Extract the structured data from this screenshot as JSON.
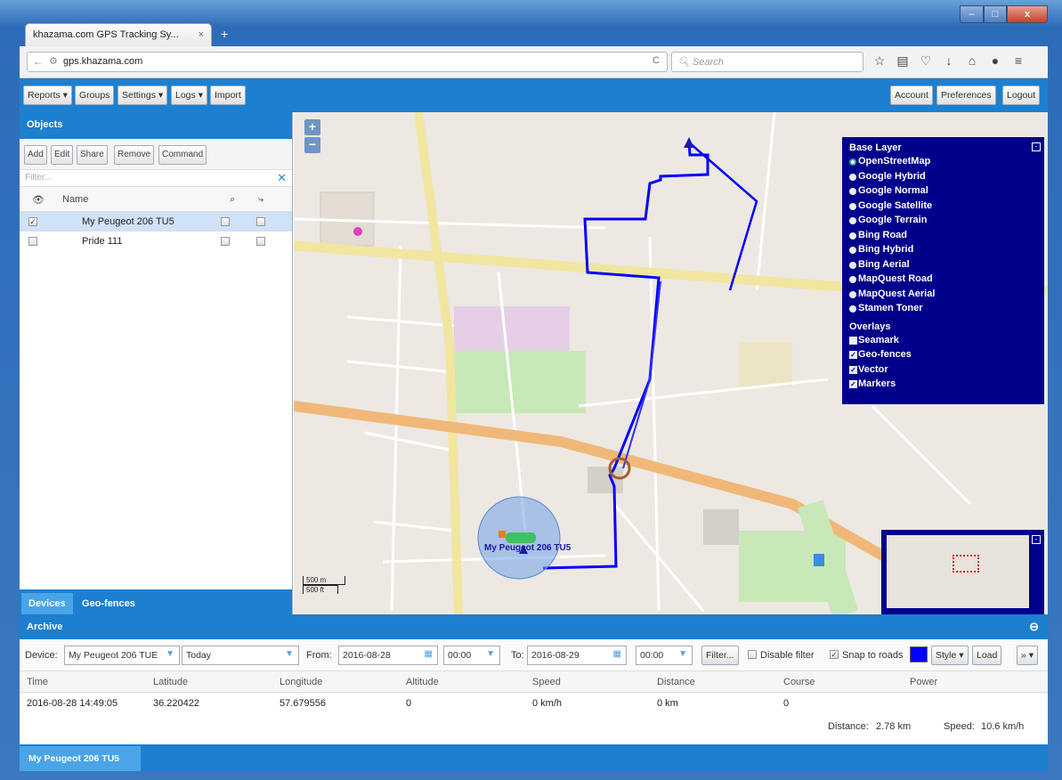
{
  "browser": {
    "tab_title": "khazama.com GPS Tracking Sy...",
    "tab_close": "×",
    "new_tab": "+",
    "url": "gps.khazama.com",
    "search_placeholder": "Search"
  },
  "toolbar": {
    "left": [
      "Reports",
      "Groups",
      "Settings",
      "Logs",
      "Import"
    ],
    "right": [
      "Account",
      "Preferences",
      "Logout"
    ]
  },
  "objects": {
    "title": "Objects",
    "buttons": [
      "Add",
      "Edit",
      "Share",
      "Remove",
      "Command"
    ],
    "filter_placeholder": "Filter...",
    "col_name": "Name",
    "rows": [
      {
        "name": "My Peugeot 206 TU5",
        "checked": true
      },
      {
        "name": "Pride 111",
        "checked": false
      }
    ],
    "tabs": [
      "Devices",
      "Geo-fences"
    ]
  },
  "map": {
    "base_layer_title": "Base Layer",
    "base_layers": [
      "OpenStreetMap",
      "Google Hybrid",
      "Google Normal",
      "Google Satellite",
      "Google Terrain",
      "Bing Road",
      "Bing Hybrid",
      "Bing Aerial",
      "MapQuest Road",
      "MapQuest Aerial",
      "Stamen Toner"
    ],
    "overlays_title": "Overlays",
    "overlays": [
      {
        "name": "Seamark",
        "checked": false
      },
      {
        "name": "Geo-fences",
        "checked": true
      },
      {
        "name": "Vector",
        "checked": true
      },
      {
        "name": "Markers",
        "checked": true
      }
    ],
    "vehicle_label": "My Peugeot 206 TU5",
    "scale_m": "500 m",
    "scale_ft": "500 ft",
    "colors": {
      "track": "#0000ff",
      "panel": "#00008b",
      "vehicle_circle": "#6fa0e8"
    }
  },
  "archive": {
    "title": "Archive",
    "device_label": "Device:",
    "device_value": "My Peugeot 206 TUE",
    "period_value": "Today",
    "from_label": "From:",
    "from_date": "2016-08-28",
    "from_time": "00:00",
    "to_label": "To:",
    "to_date": "2016-08-29",
    "to_time": "00:00",
    "filter_btn": "Filter...",
    "disable_filter": "Disable filter",
    "snap_to_roads": "Snap to roads",
    "style_btn": "Style",
    "load_btn": "Load",
    "more_btn": "»",
    "columns": [
      "Time",
      "Latitude",
      "Longitude",
      "Altitude",
      "Speed",
      "Distance",
      "Course",
      "Power"
    ],
    "row": [
      "2016-08-28 14:49:05",
      "36.220422",
      "57.679556",
      "0",
      "0 km/h",
      "0 km",
      "0",
      ""
    ],
    "distance_label": "Distance:",
    "distance_value": "2.78 km",
    "speed_label": "Speed:",
    "speed_value": "10.6 km/h",
    "footer_tab": "My Peugeot 206 TU5"
  }
}
